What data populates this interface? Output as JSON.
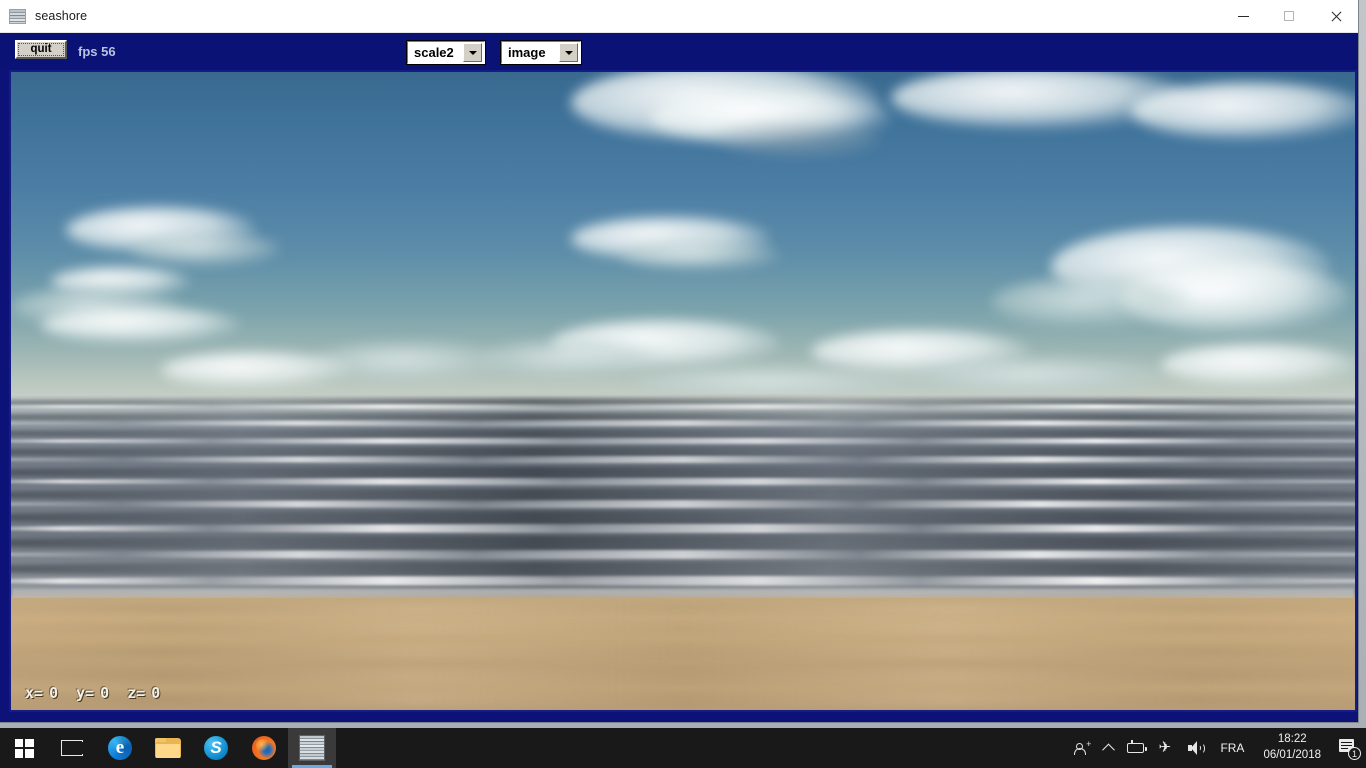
{
  "window": {
    "title": "seashore",
    "icon": "seashore-thumbnail-icon",
    "controls": {
      "minimize": "minimize-button",
      "maximize": "maximize-button",
      "close": "close-button"
    }
  },
  "toolbar": {
    "quit_label": "quit",
    "fps_label": "fps 56",
    "scale_select": {
      "value": "scale2",
      "options": [
        "scale2"
      ]
    },
    "mode_select": {
      "value": "image",
      "options": [
        "image"
      ]
    },
    "background_color": "#0b1276"
  },
  "scene": {
    "description": "seashore: blue sky with clouds over an ocean with breaking waves and a sandy beach",
    "sky_color": "#3f7299",
    "sea_color": "#6f7883",
    "sand_color": "#c5a87c",
    "hud": {
      "x_label": "x=",
      "x_value": "0",
      "y_label": "y=",
      "y_value": "0",
      "z_label": "z=",
      "z_value": "0"
    }
  },
  "taskbar": {
    "background_color": "#191919",
    "items": [
      {
        "name": "start-button",
        "icon": "windows-logo-icon",
        "label": ""
      },
      {
        "name": "task-view-button",
        "icon": "task-view-icon",
        "label": ""
      },
      {
        "name": "edge-button",
        "icon": "edge-icon",
        "label": ""
      },
      {
        "name": "file-explorer-button",
        "icon": "folder-icon",
        "label": ""
      },
      {
        "name": "skype-button",
        "icon": "skype-icon",
        "label": ""
      },
      {
        "name": "firefox-button",
        "icon": "firefox-icon",
        "label": ""
      },
      {
        "name": "seashore-taskbar-button",
        "icon": "seashore-thumbnail-icon",
        "label": "",
        "active": true
      }
    ],
    "tray": {
      "people_icon": "people-icon",
      "chevron_label": "show-hidden-icons",
      "battery_icon": "battery-icon",
      "airplane_icon": "airplane-mode-icon",
      "volume_icon": "volume-icon",
      "language": "FRA",
      "time": "18:22",
      "date": "06/01/2018",
      "notification_count": "1"
    }
  }
}
